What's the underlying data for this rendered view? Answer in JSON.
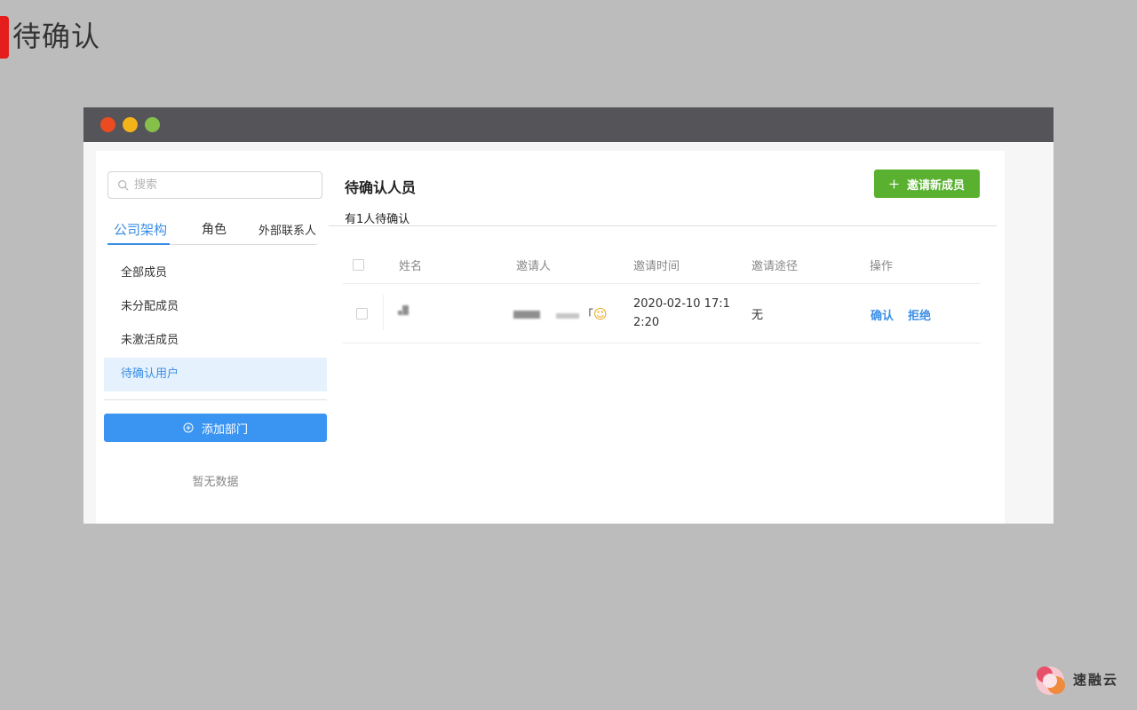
{
  "slide": {
    "title": "待确认"
  },
  "sidebar": {
    "search_placeholder": "搜索",
    "tabs": [
      {
        "label": "公司架构",
        "active": true
      },
      {
        "label": "角色"
      },
      {
        "label": "外部联系人"
      }
    ],
    "nav_items": [
      {
        "label": "全部成员"
      },
      {
        "label": "未分配成员"
      },
      {
        "label": "未激活成员"
      },
      {
        "label": "待确认用户",
        "active": true
      }
    ],
    "add_dept_label": "添加部门",
    "empty_text": "暂无数据"
  },
  "main": {
    "title": "待确认人员",
    "subtitle": "有1人待确认",
    "invite_button": "邀请新成员",
    "table": {
      "headers": [
        "姓名",
        "邀请人",
        "邀请时间",
        "邀请途径",
        "操作"
      ],
      "rows": [
        {
          "inviter_suffix": "「",
          "inviter_emoji": "☺",
          "time": "2020-02-10 17:12:20",
          "channel": "无",
          "actions": [
            "确认",
            "拒绝"
          ]
        }
      ]
    }
  },
  "brand": {
    "name": "速融云"
  },
  "colors": {
    "accent_blue": "#3a8ee6",
    "invite_green": "#5ab12f",
    "slide_red": "#e51d1d",
    "titlebar": "#545459"
  }
}
